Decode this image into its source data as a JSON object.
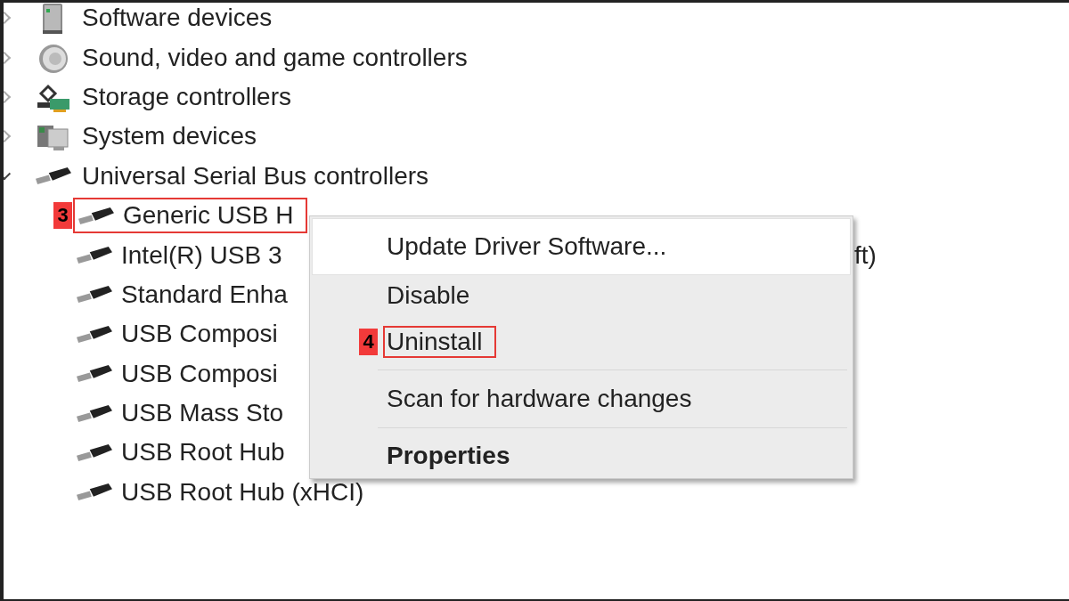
{
  "tree": {
    "items": [
      {
        "label": "Software devices",
        "kind": "device",
        "expanded": false
      },
      {
        "label": "Sound, video and game controllers",
        "kind": "speaker",
        "expanded": false
      },
      {
        "label": "Storage controllers",
        "kind": "storage",
        "expanded": false
      },
      {
        "label": "System devices",
        "kind": "system",
        "expanded": false
      },
      {
        "label": "Universal Serial Bus controllers",
        "kind": "usb",
        "expanded": true,
        "children": [
          {
            "label": "Generic USB H",
            "kind": "usb",
            "step": "3"
          },
          {
            "label": "Intel(R) USB 3",
            "kind": "usb",
            "tail": "ft)"
          },
          {
            "label": "Standard Enha",
            "kind": "usb"
          },
          {
            "label": "USB Composi",
            "kind": "usb"
          },
          {
            "label": "USB Composi",
            "kind": "usb"
          },
          {
            "label": "USB Mass Sto",
            "kind": "usb"
          },
          {
            "label": "USB Root Hub",
            "kind": "usb"
          },
          {
            "label": "USB Root Hub (xHCI)",
            "kind": "usb"
          }
        ]
      }
    ]
  },
  "context_menu": {
    "items": [
      {
        "kind": "item",
        "label": "Update Driver Software...",
        "selected": true,
        "bold": false
      },
      {
        "kind": "item",
        "label": "Disable",
        "selected": false,
        "bold": false
      },
      {
        "kind": "item",
        "label": "Uninstall",
        "selected": false,
        "bold": false,
        "step": "4"
      },
      {
        "kind": "separator"
      },
      {
        "kind": "item",
        "label": "Scan for hardware changes",
        "selected": false,
        "bold": false
      },
      {
        "kind": "separator"
      },
      {
        "kind": "item",
        "label": "Properties",
        "selected": false,
        "bold": true
      }
    ]
  }
}
